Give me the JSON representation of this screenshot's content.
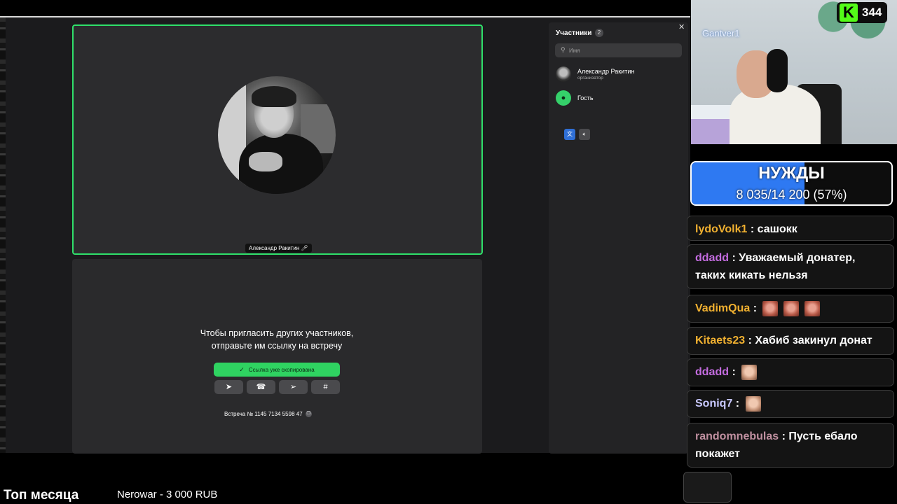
{
  "meeting": {
    "speaker_name": "Александр Ракитин",
    "speaker_mic_icon": "mic-icon",
    "invite_line1": "Чтобы пригласить других участников,",
    "invite_line2": "отправьте им ссылку на встречу",
    "copied_label": "Ссылка уже скопирована",
    "share_icons": [
      "telegram-icon",
      "whatsapp-icon",
      "send-icon",
      "slack-icon"
    ],
    "meeting_id": "Встреча № 1145 7134 5598 47"
  },
  "participants": {
    "title": "Участники",
    "count": "2",
    "search_placeholder": "Имя",
    "items": [
      {
        "name": "Александр Ракитин",
        "role": "организатор"
      },
      {
        "name": "Гость",
        "role": ""
      }
    ]
  },
  "stream": {
    "webcam_name": "Gantver1",
    "viewer_count": "344",
    "accent_kick": "#53fc18"
  },
  "goal": {
    "title": "НУЖДЫ",
    "progress_text": "8 035/14 200 (57%)",
    "current": 8035,
    "target": 14200,
    "fill_color": "#2e79f2"
  },
  "chat": [
    {
      "user": "lydoVolk1",
      "color": "#f0b030",
      "text": "сашокк",
      "emotes": 0
    },
    {
      "user": "ddadd",
      "color": "#c46ce0",
      "text": "Уважаемый донатер, таких кикать нельзя",
      "emotes": 0
    },
    {
      "user": "VadimQua",
      "color": "#f0b030",
      "text": "",
      "emotes": 3
    },
    {
      "user": "Kitaets23",
      "color": "#f0b030",
      "text": "Хабиб закинул донат",
      "emotes": 0
    },
    {
      "user": "ddadd",
      "color": "#c46ce0",
      "text": "",
      "emotes": 1
    },
    {
      "user": "Soniq7",
      "color": "#c8c8ff",
      "text": "",
      "emotes": 1
    },
    {
      "user": "randomnebulas",
      "color": "#c090a0",
      "text": "Пусть ебало покажет",
      "emotes": 0
    }
  ],
  "bottom": {
    "top_label": "Топ месяца",
    "top_entry": "Nerowar - 3 000 RUB"
  }
}
